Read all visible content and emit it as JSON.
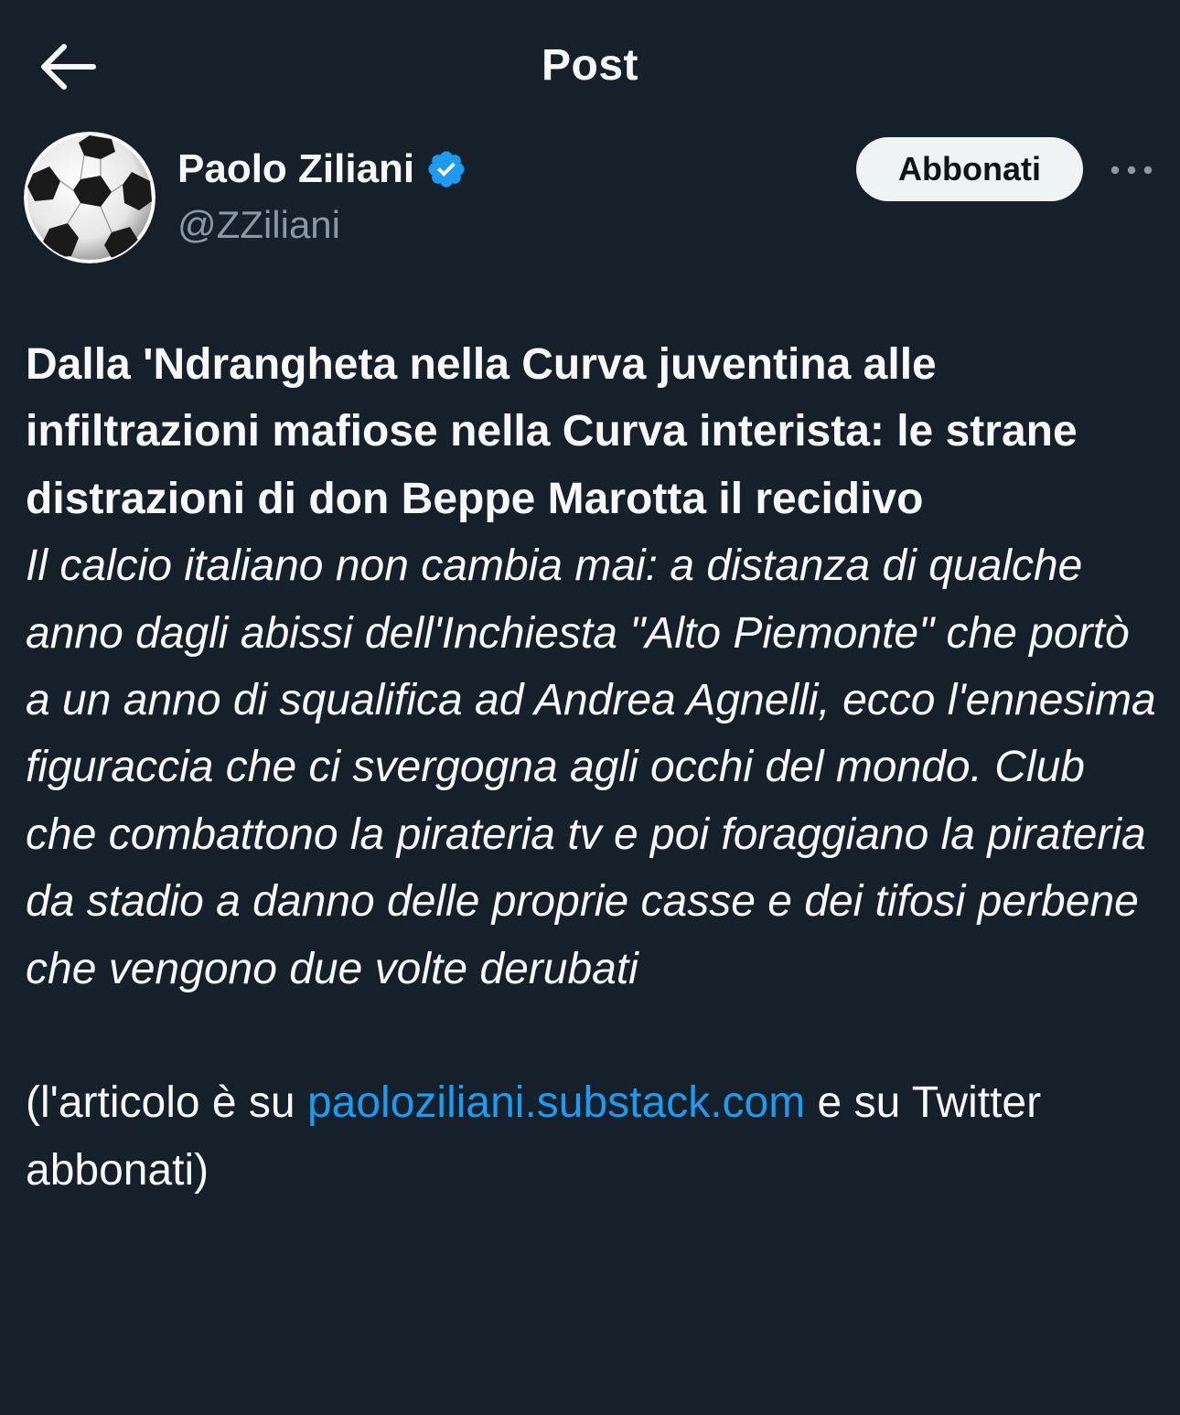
{
  "header": {
    "title": "Post",
    "back_icon": "arrow-left-icon"
  },
  "author": {
    "name": "Paolo Ziliani",
    "handle": "@ZZiliani",
    "verified": true,
    "avatar": "soccer-ball-icon"
  },
  "actions": {
    "subscribe_label": "Abbonati",
    "more_icon": "more-horizontal-icon"
  },
  "post": {
    "heading": "Dalla 'Ndrangheta nella Curva juventina alle infiltrazioni mafiose nella Curva interista: le strane distrazioni di don Beppe Marotta il recidivo",
    "subtitle": "Il calcio italiano non cambia mai: a distanza di qualche anno dagli abissi dell'Inchiesta \"Alto Piemonte\" che portò a un anno di squalifica ad Andrea Agnelli, ecco l'ennesima figuraccia che ci svergogna agli occhi del mondo. Club che combattono la pirateria tv e poi foraggiano la pirateria da stadio a danno delle proprie casse e dei tifosi perbene che vengono due volte derubati",
    "footer_prefix": "(l'articolo è su ",
    "footer_link": "paoloziliani.substack.com",
    "footer_suffix": " e su Twitter abbonati)"
  },
  "colors": {
    "background": "#15202b",
    "text": "#f7f9f9",
    "secondary_text": "#8b98a5",
    "link": "#1d9bf0",
    "verified_badge": "#1d9bf0",
    "button_bg": "#eff3f4"
  }
}
